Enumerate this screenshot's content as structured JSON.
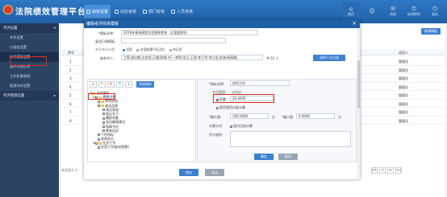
{
  "app": {
    "title": "法院绩效管理平台"
  },
  "nav_tabs": [
    {
      "label": "绩效设置"
    },
    {
      "label": "动态考核"
    },
    {
      "label": "部门考核"
    },
    {
      "label": "人员考核"
    }
  ],
  "right_nav": [
    {
      "label": "首页",
      "icon": "home-icon"
    },
    {
      "label": "",
      "icon": "user-icon"
    },
    {
      "label": "",
      "icon": "message-icon"
    },
    {
      "label": "",
      "icon": "lock-icon"
    },
    {
      "label": "",
      "icon": "power-icon"
    }
  ],
  "right_small": [
    "消息",
    "修改密码",
    "退出"
  ],
  "sidebar": {
    "sections": [
      {
        "label": "考评设置"
      },
      {
        "label": "考评管理设置"
      }
    ],
    "items": [
      {
        "label": "考评设置"
      },
      {
        "label": "分类组设置"
      },
      {
        "label": "体系模板设置"
      },
      {
        "label": "维护考核信息"
      },
      {
        "label": "工作权重限制"
      },
      {
        "label": "管理评价设置"
      }
    ]
  },
  "main": {
    "add_button": "新增模板",
    "columns": [
      "序号",
      "",
      "",
      "",
      "",
      "",
      "",
      "",
      "",
      "",
      "",
      "适用人"
    ],
    "rows": [
      {
        "no": "1",
        "applicable": "管理员"
      },
      {
        "no": "2",
        "applicable": "管理员"
      },
      {
        "no": "3",
        "applicable": "管理员"
      },
      {
        "no": "4",
        "applicable": "管理员"
      },
      {
        "no": "5",
        "applicable": "管理员"
      },
      {
        "no": "6",
        "applicable": "管理员"
      },
      {
        "no": "7",
        "applicable": "管理员"
      },
      {
        "no": "8",
        "applicable": "管理员"
      }
    ],
    "pager_text": "本页显示 1 - ",
    "pager_buttons": [
      "|<",
      "<",
      ">",
      ">|"
    ]
  },
  "modal": {
    "title": "编辑考评体系模板",
    "fields": {
      "name_label": "*模板名称:",
      "name_value": "2019年青海高院法官绩效考核（立案庭除外）",
      "parent_label": "复用已建模板:",
      "parent_value": "",
      "type_label": "考评体系分类:",
      "type_options": [
        {
          "label": "法官",
          "on": true
        },
        {
          "label": "法官助理(书记员)",
          "on": false
        },
        {
          "label": "书记员",
          "on": false
        }
      ],
      "people_label": "被考评人:",
      "people_value": "兰莉;胡红鹤;庄良坚;王雄;陈晓;刘一;李明;张立;王锐;李卫华;何立坚;苏海;杨丽娟;",
      "people_count": "共 62 人",
      "select_people_button": "选择人员分组"
    },
    "tree_toolbar": [
      {
        "glyph": "+",
        "icon": "add-icon"
      },
      {
        "glyph": "✎",
        "icon": "edit-icon"
      },
      {
        "glyph": "✕",
        "icon": "delete-icon"
      },
      {
        "glyph": "↑",
        "icon": "up-icon"
      },
      {
        "glyph": "↓",
        "icon": "down-icon"
      }
    ],
    "add_indicator_button": "添加指标",
    "tree": [
      {
        "label": "全部指标",
        "level": 0
      },
      {
        "label": "综合工作",
        "level": 1
      },
      {
        "label": "审判质效",
        "level": 2
      },
      {
        "label": "政治品德",
        "level": 2
      },
      {
        "label": "政治表现",
        "level": 3
      },
      {
        "label": "理论学习",
        "level": 3
      },
      {
        "label": "履职考勤",
        "level": 3
      },
      {
        "label": "党风廉政建设",
        "level": 3
      },
      {
        "label": "遵章守纪",
        "level": 3
      },
      {
        "label": "教育培训",
        "level": 3
      },
      {
        "label": "个性指标",
        "level": 2
      },
      {
        "label": "其他加分",
        "level": 2
      },
      {
        "label": "业务工作",
        "level": 1
      },
      {
        "label": "办案工作量(结案数)",
        "level": 2
      }
    ],
    "detail": {
      "node_name_label": "*指标名称:",
      "node_name_value": "综合工作",
      "parent_label": "节点类型:",
      "parent_value": "父节点",
      "weight_label": "权重:",
      "weight_value": "20.0000",
      "scoring_label": "是否使用分值计算",
      "max_label": "*最大值:",
      "max_value": "100.0000",
      "max_unit": "分",
      "min_label": "*最小值:",
      "min_value": "0.0000",
      "min_unit": "分",
      "calc_label": "计算方式:",
      "calc_option": "组内比较计算",
      "desc_label": "评分规则:",
      "ok_button": "确定",
      "cancel_button": "取消"
    },
    "footer": {
      "save_button": "保存",
      "close_button": "关闭"
    }
  },
  "colors": {
    "header": "#1f5fa6",
    "sidebar": "#2c4463",
    "accent": "#3d7fd1",
    "highlight_box": "#e0281d"
  }
}
